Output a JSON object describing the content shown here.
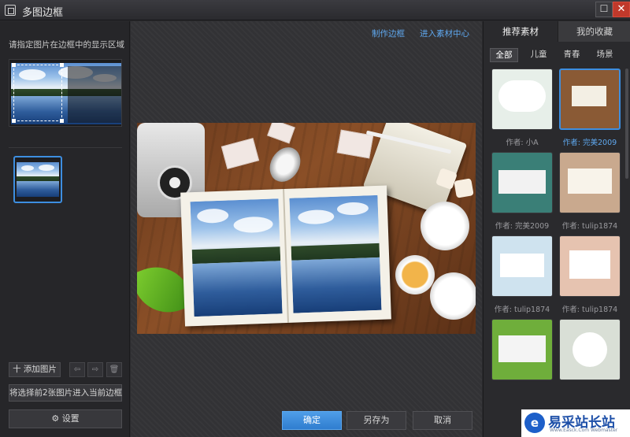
{
  "window": {
    "title": "多图边框",
    "maximize_glyph": "☐",
    "close_glyph": "✕"
  },
  "left_panel": {
    "hint": "请指定图片在边框中的显示区域",
    "add_image": "十 添加图片",
    "move_left_glyph": "⇦",
    "move_right_glyph": "⇨",
    "delete_glyph": "🗑",
    "import_label": "将选择前2张图片进入当前边框",
    "settings_glyph": "⚙",
    "settings_label": "设置"
  },
  "center_panel": {
    "make_frame": "制作边框",
    "material_center": "进入素材中心",
    "confirm": "确定",
    "save_as": "另存为",
    "cancel": "取消"
  },
  "right_panel": {
    "tabs": [
      "推荐素材",
      "我的收藏"
    ],
    "active_tab": 0,
    "subtabs": [
      "全部",
      "儿童",
      "青春",
      "场景"
    ],
    "active_subtab": 0,
    "frames": [
      {
        "author": "作者: 小A",
        "icon": "frame-thumbnail-icon"
      },
      {
        "author": "作者: 完美2009",
        "icon": "frame-thumbnail-icon",
        "selected": true
      },
      {
        "author": "作者: 完美2009",
        "icon": "frame-thumbnail-icon"
      },
      {
        "author": "作者: tulip1874",
        "icon": "frame-thumbnail-icon"
      },
      {
        "author": "作者: tulip1874",
        "icon": "frame-thumbnail-icon"
      },
      {
        "author": "作者: tulip1874",
        "icon": "frame-thumbnail-icon"
      },
      {
        "author": "",
        "icon": "frame-thumbnail-icon"
      },
      {
        "author": "",
        "icon": "frame-thumbnail-icon"
      }
    ]
  },
  "watermark": {
    "logo_glyph": "e",
    "text": "易采站长站",
    "sub": "Www.Easck.Com Webmaster"
  },
  "colors": {
    "accent": "#3d8ee0",
    "link": "#5fa8ef",
    "close_button": "#c0392b"
  }
}
